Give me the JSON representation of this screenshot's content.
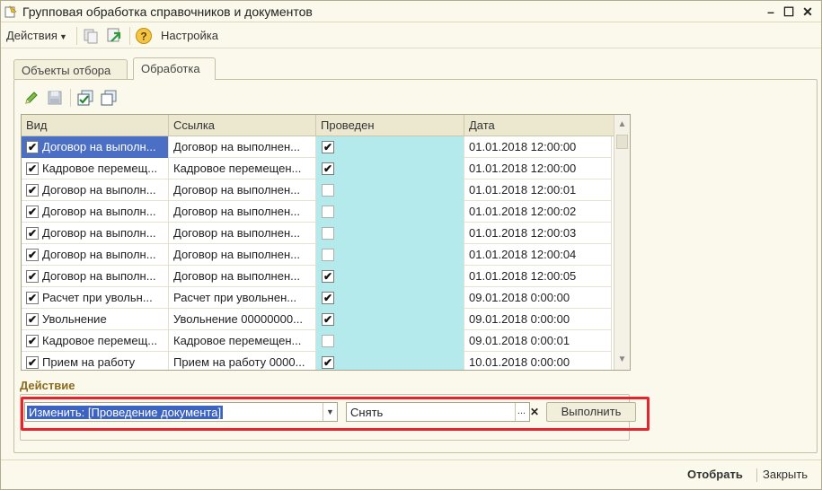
{
  "window": {
    "title": "Групповая обработка справочников и документов",
    "minimize": "–",
    "maximize": "☐",
    "close": "✕"
  },
  "toolbar": {
    "actions_label": "Действия",
    "settings_label": "Настройка"
  },
  "tabs": [
    {
      "label": "Объекты отбора",
      "active": false
    },
    {
      "label": "Обработка",
      "active": true
    }
  ],
  "grid": {
    "columns": [
      "Вид",
      "Ссылка",
      "Проведен",
      "Дата"
    ],
    "rows": [
      {
        "checked": true,
        "kind": "Договор на выполн...",
        "ref": "Договор на выполнен...",
        "posted": true,
        "date": "01.01.2018 12:00:00",
        "selected": true
      },
      {
        "checked": true,
        "kind": "Кадровое перемещ...",
        "ref": "Кадровое перемещен...",
        "posted": true,
        "date": "01.01.2018 12:00:00",
        "selected": false
      },
      {
        "checked": true,
        "kind": "Договор на выполн...",
        "ref": "Договор на выполнен...",
        "posted": false,
        "date": "01.01.2018 12:00:01",
        "selected": false
      },
      {
        "checked": true,
        "kind": "Договор на выполн...",
        "ref": "Договор на выполнен...",
        "posted": false,
        "date": "01.01.2018 12:00:02",
        "selected": false
      },
      {
        "checked": true,
        "kind": "Договор на выполн...",
        "ref": "Договор на выполнен...",
        "posted": false,
        "date": "01.01.2018 12:00:03",
        "selected": false
      },
      {
        "checked": true,
        "kind": "Договор на выполн...",
        "ref": "Договор на выполнен...",
        "posted": false,
        "date": "01.01.2018 12:00:04",
        "selected": false
      },
      {
        "checked": true,
        "kind": "Договор на выполн...",
        "ref": "Договор на выполнен...",
        "posted": true,
        "date": "01.01.2018 12:00:05",
        "selected": false
      },
      {
        "checked": true,
        "kind": "Расчет при увольн...",
        "ref": "Расчет при увольнен...",
        "posted": true,
        "date": "09.01.2018 0:00:00",
        "selected": false
      },
      {
        "checked": true,
        "kind": "Увольнение",
        "ref": "Увольнение 00000000...",
        "posted": true,
        "date": "09.01.2018 0:00:00",
        "selected": false
      },
      {
        "checked": true,
        "kind": "Кадровое перемещ...",
        "ref": "Кадровое перемещен...",
        "posted": false,
        "date": "09.01.2018 0:00:01",
        "selected": false
      },
      {
        "checked": true,
        "kind": "Прием на работу",
        "ref": "Прием на работу 0000...",
        "posted": true,
        "date": "10.01.2018 0:00:00",
        "selected": false
      }
    ]
  },
  "action": {
    "label": "Действие",
    "combo_value": "Изменить: [Проведение документа]",
    "value_field": "Снять",
    "run_label": "Выполнить"
  },
  "footer": {
    "ok_label": "Отобрать",
    "close_label": "Закрыть"
  },
  "colors": {
    "accent_frame": "#e8232e",
    "posted_cell": "#b4eaec",
    "selection": "#4b6fc4"
  }
}
